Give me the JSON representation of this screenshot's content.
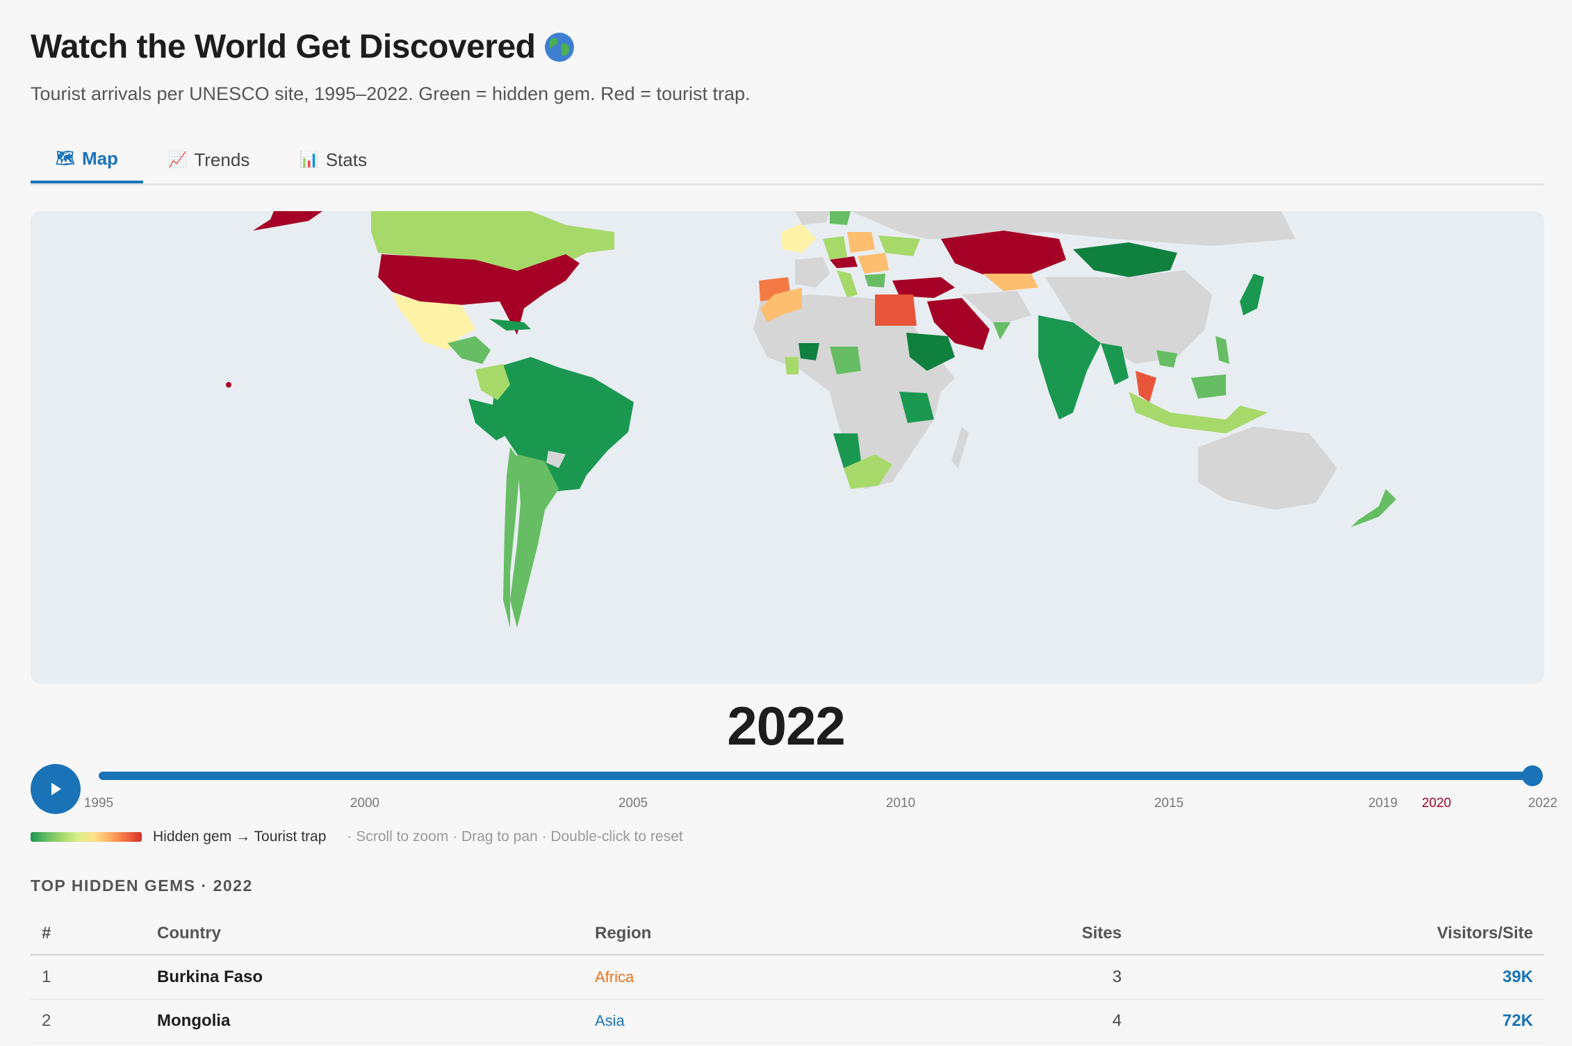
{
  "header": {
    "title": "Watch the World Get Discovered",
    "title_icon": "globe-emoji",
    "subtitle": "Tourist arrivals per UNESCO site, 1995–2022. Green = hidden gem. Red = tourist trap."
  },
  "tabs": [
    {
      "label": "Map",
      "icon": "map-icon",
      "active": true
    },
    {
      "label": "Trends",
      "icon": "trend-chart-icon",
      "active": false
    },
    {
      "label": "Stats",
      "icon": "bar-chart-icon",
      "active": false
    }
  ],
  "map": {
    "colors": {
      "trap_dark": "#a50026",
      "trap": "#e8553a",
      "orange": "#f47a45",
      "light_orange": "#fdbe70",
      "yellow": "#fef2a6",
      "lime": "#a6d96a",
      "green": "#66bd63",
      "green_mid": "#1a9850",
      "green_dark": "#10803f",
      "no_data": "#d6d6d6",
      "ocean": "#e8edf1"
    }
  },
  "timeline": {
    "current_year": "2022",
    "progress": 1.0,
    "ticks": [
      {
        "label": "1995",
        "highlight": false
      },
      {
        "label": "2000",
        "highlight": false
      },
      {
        "label": "2005",
        "highlight": false
      },
      {
        "label": "2010",
        "highlight": false
      },
      {
        "label": "2015",
        "highlight": false
      },
      {
        "label": "2019",
        "highlight": false
      },
      {
        "label": "2020",
        "highlight": true
      },
      {
        "label": "2022",
        "highlight": false
      }
    ]
  },
  "legend": {
    "label": "Hidden gem → Tourist trap",
    "hint": "· Scroll to zoom · Drag to pan · Double-click to reset"
  },
  "top_gems": {
    "heading": "TOP HIDDEN GEMS · 2022",
    "columns": {
      "rank": "#",
      "country": "Country",
      "region": "Region",
      "sites": "Sites",
      "visitors": "Visitors/Site"
    },
    "rows": [
      {
        "rank": "1",
        "country": "Burkina Faso",
        "region": "Africa",
        "sites": "3",
        "visitors": "39K"
      },
      {
        "rank": "2",
        "country": "Mongolia",
        "region": "Asia",
        "sites": "4",
        "visitors": "72K"
      }
    ]
  }
}
